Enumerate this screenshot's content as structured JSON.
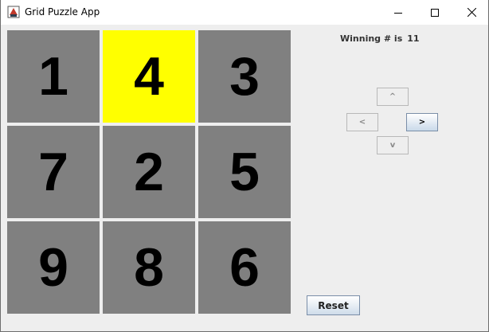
{
  "window": {
    "title": "Grid Puzzle App",
    "controls": {
      "minimize": "minimize-icon",
      "maximize": "maximize-icon",
      "close": "close-icon"
    }
  },
  "grid": {
    "rows": 3,
    "columns": 3,
    "tiles": [
      "1",
      "4",
      "3",
      "7",
      "2",
      "5",
      "9",
      "8",
      "6"
    ],
    "selected_tile": "4",
    "colors": {
      "tile": "#808080",
      "selected": "#ffff00",
      "text": "#000000"
    }
  },
  "status": {
    "winning_label": "Winning # is",
    "winning_value": "11"
  },
  "controls": {
    "up_label": "^",
    "left_label": "<",
    "right_label": ">",
    "down_label": "v",
    "reset_label": "Reset"
  }
}
